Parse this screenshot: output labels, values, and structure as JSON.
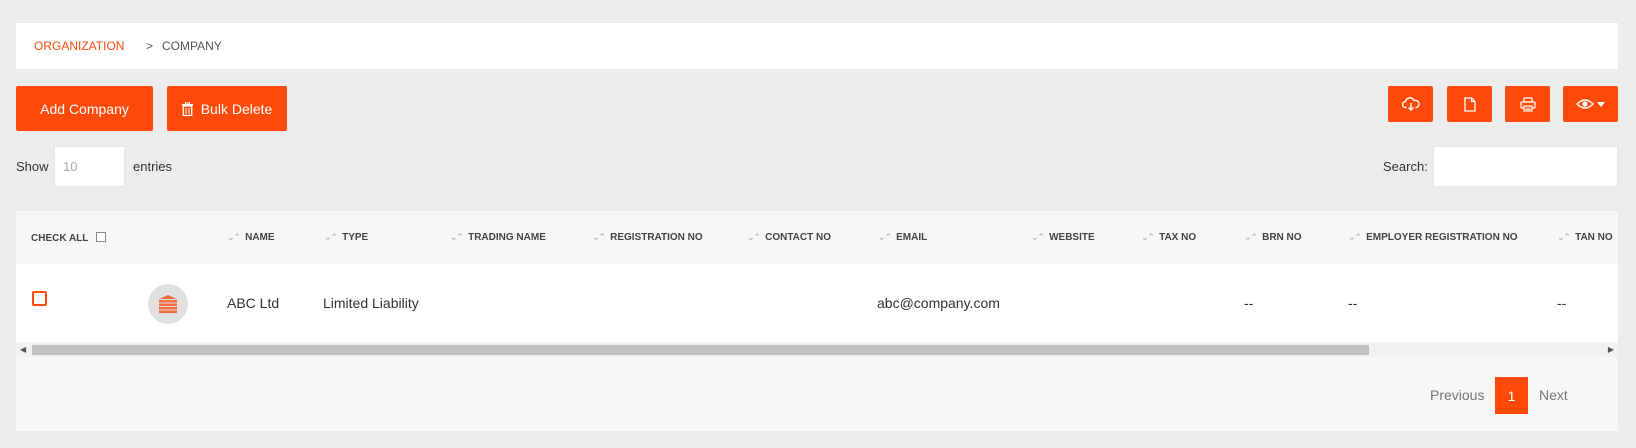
{
  "breadcrumb": {
    "root": "ORGANIZATION",
    "separator": ">",
    "current": "COMPANY"
  },
  "toolbar": {
    "add_label": "Add Company",
    "bulk_delete_label": "Bulk Delete",
    "icons": [
      "cloud-download-icon",
      "file-icon",
      "print-icon",
      "eye-icon"
    ]
  },
  "length": {
    "show_label": "Show",
    "value": "10",
    "entries_label": "entries"
  },
  "search": {
    "label": "Search:",
    "value": ""
  },
  "table": {
    "check_all_label": "CHECK ALL",
    "columns": [
      "NAME",
      "TYPE",
      "TRADING NAME",
      "REGISTRATION NO",
      "CONTACT NO",
      "EMAIL",
      "WEBSITE",
      "TAX NO",
      "BRN NO",
      "EMPLOYER REGISTRATION NO",
      "TAN NO"
    ],
    "rows": [
      {
        "name": "ABC Ltd",
        "type": "Limited Liability",
        "trading_name": "",
        "registration_no": "",
        "contact_no": "",
        "email": "abc@company.com",
        "website": "",
        "tax_no": "",
        "brn_no": "--",
        "employer_registration_no": "--",
        "tan_no": "--"
      }
    ]
  },
  "pagination": {
    "previous": "Previous",
    "current_page": "1",
    "next": "Next"
  },
  "colors": {
    "accent": "#ff4a0a",
    "background": "#ececec"
  }
}
